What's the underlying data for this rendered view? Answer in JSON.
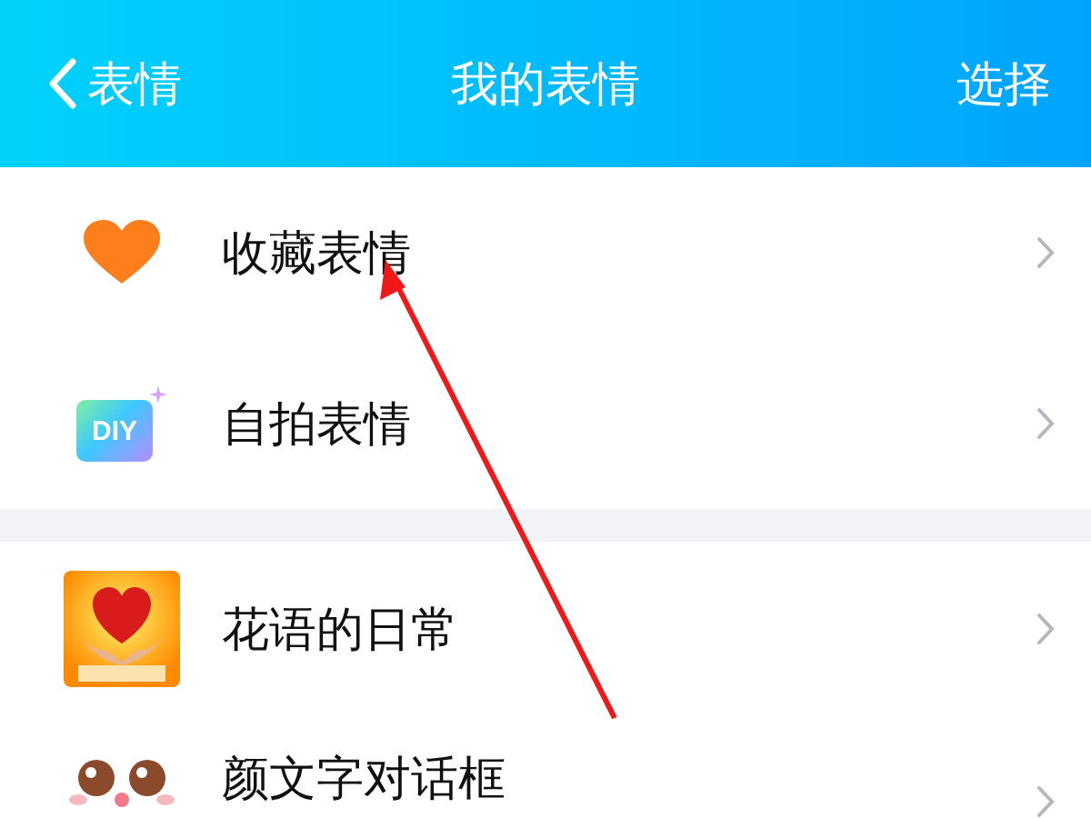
{
  "header": {
    "back_label": "表情",
    "title": "我的表情",
    "action": "选择"
  },
  "groups": [
    {
      "items": [
        {
          "kind": "heart",
          "label": "收藏表情"
        },
        {
          "kind": "diy",
          "icon_text": "DIY",
          "label": "自拍表情"
        }
      ]
    },
    {
      "items": [
        {
          "kind": "sticker",
          "label": "花语的日常"
        },
        {
          "kind": "face",
          "label": "颜文字对话框"
        }
      ]
    }
  ],
  "annotation": {
    "kind": "arrow"
  }
}
